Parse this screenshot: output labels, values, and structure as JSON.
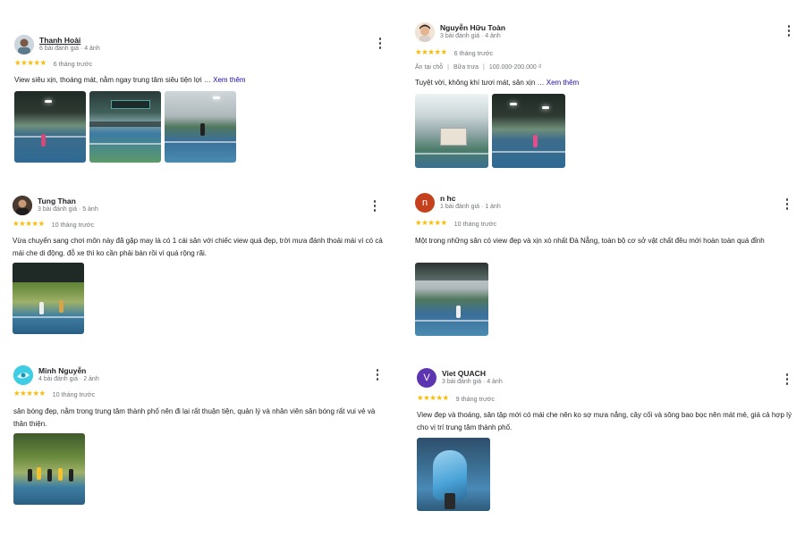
{
  "colors": {
    "star": "#fbbc04",
    "link": "#1a0dab",
    "meta": "#70757a"
  },
  "reviews": [
    {
      "name": "Thanh Hoài",
      "meta": "6 bài đánh giá · 4 ảnh",
      "stars": "★★★★★",
      "time": "6 tháng trước",
      "text": "View siêu xịn, thoáng mát, nằm ngay trung tâm siêu tiện lợi …",
      "more_label": "Xem thêm",
      "avatar_icon": "user-photo-icon"
    },
    {
      "name": "Nguyễn Hữu Toàn",
      "meta": "3 bài đánh giá · 4 ảnh",
      "stars": "★★★★★",
      "time": "6 tháng trước",
      "tags": [
        "Ăn tại chỗ",
        "Bữa trưa",
        "100.000-200.000 ₫"
      ],
      "text": "Tuyệt vời, không khí tươi mát, sân xịn …",
      "more_label": "Xem thêm",
      "avatar_icon": "user-photo-icon"
    },
    {
      "name": "Tung Than",
      "meta": "3 bài đánh giá · 5 ảnh",
      "stars": "★★★★★",
      "time": "10 tháng trước",
      "text": "Vừa chuyển sang chơi môn này đã gặp may là có 1 cái sân với chiếc view quá đẹp, trời mưa đánh thoải mái vì có cả mái che di động. đỗ xe thì ko cần phải bàn rồi vì quá rộng rãi.",
      "avatar_icon": "user-photo-icon"
    },
    {
      "name": "n hc",
      "meta": "1 bài đánh giá · 1 ảnh",
      "stars": "★★★★★",
      "time": "10 tháng trước",
      "text": "Một trong những sân có view đẹp và xịn xò nhất Đà Nẵng, toàn bộ cơ sở vật chất đều mới hoàn toàn quá đỉnh",
      "avatar_letter": "n",
      "avatar_color": "#c5411e"
    },
    {
      "name": "Minh Nguyễn",
      "meta": "4 bài đánh giá · 2 ảnh",
      "stars": "★★★★★",
      "time": "10 tháng trước",
      "text": "sân bóng đẹp, nằm trong trung tâm thành phố nên đi lại rất thuận tiện, quản lý và nhân viên sân bóng rất vui vẻ và thân thiện.",
      "avatar_icon": "user-photo-icon"
    },
    {
      "name": "Viet QUACH",
      "meta": "3 bài đánh giá · 4 ảnh",
      "stars": "★★★★★",
      "time": "9 tháng trước",
      "text": "View đẹp và thoáng, sân tập mới có mái che nên ko sợ mưa nắng, cây cối và sông bao bọc nên mát mẻ, giá cả hợp lý cho vị trí trung tâm thành phố.",
      "avatar_letter": "V",
      "avatar_color": "#5e35b1"
    }
  ]
}
